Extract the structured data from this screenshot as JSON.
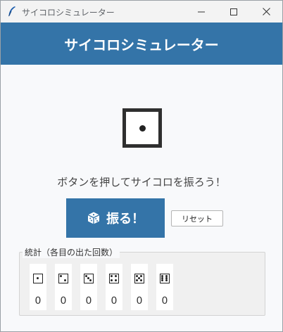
{
  "window": {
    "title": "サイコロシミュレーター"
  },
  "header": {
    "title": "サイコロシミュレーター"
  },
  "dice": {
    "current_value": 1
  },
  "message": "ボタンを押してサイコロを振ろう！",
  "buttons": {
    "roll_label": "振る！",
    "reset_label": "リセット"
  },
  "stats": {
    "legend": "統計（各目の出た回数）",
    "faces": [
      {
        "face": 1,
        "count": "0"
      },
      {
        "face": 2,
        "count": "0"
      },
      {
        "face": 3,
        "count": "0"
      },
      {
        "face": 4,
        "count": "0"
      },
      {
        "face": 5,
        "count": "0"
      },
      {
        "face": 6,
        "count": "0"
      }
    ]
  },
  "colors": {
    "accent": "#3474a8",
    "background": "#f8f9fb"
  },
  "icons": {
    "app": "feather-icon",
    "roll": "dice-icon"
  }
}
